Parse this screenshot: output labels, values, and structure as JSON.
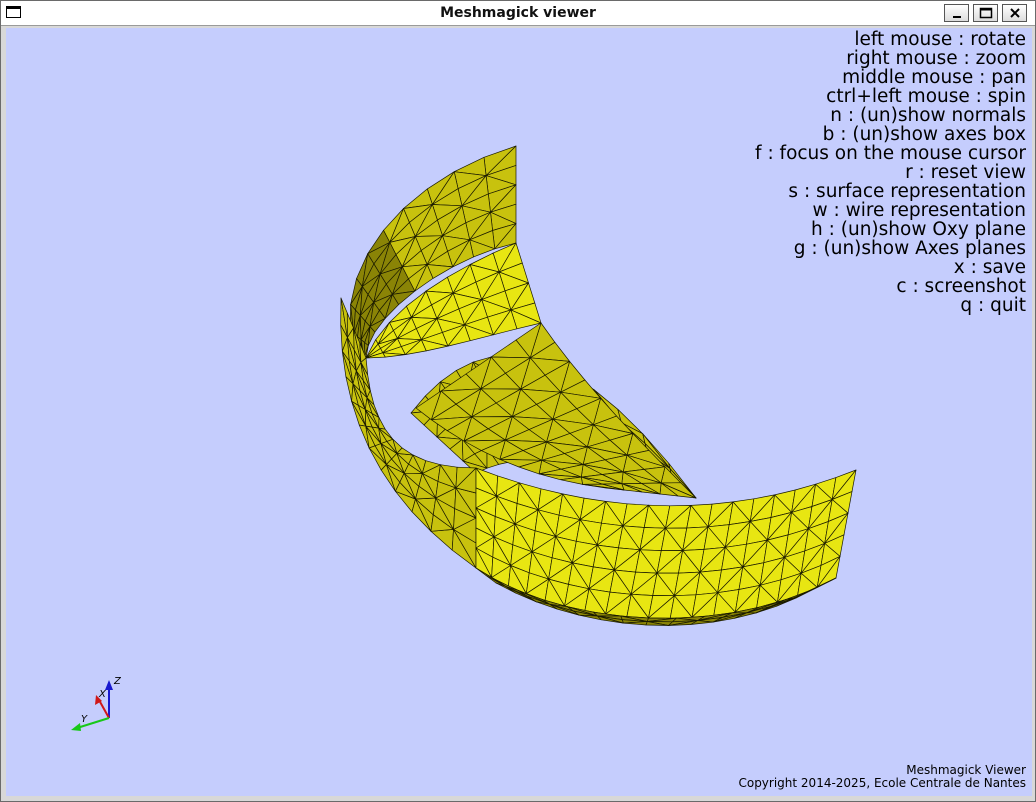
{
  "window": {
    "title": "Meshmagick viewer"
  },
  "help_lines": [
    "left mouse : rotate",
    "right mouse : zoom",
    "middle mouse : pan",
    "ctrl+left mouse : spin",
    "n : (un)show normals",
    "b : (un)show axes box",
    "f : focus on the mouse cursor",
    "r : reset view",
    "s : surface representation",
    "w : wire representation",
    "h : (un)show Oxy plane",
    "g : (un)show Axes planes",
    "x : save",
    "c : screenshot",
    "q : quit"
  ],
  "footer": {
    "app_name": "Meshmagick Viewer",
    "copyright": "Copyright 2014-2025, Ecole Centrale de Nantes"
  },
  "axes": {
    "x_label": "X",
    "y_label": "Y",
    "z_label": "Z",
    "x_color": "#d01818",
    "y_color": "#18c818",
    "z_color": "#1818d0"
  },
  "colors": {
    "viewport_bg": "#c5cdfd",
    "mesh_light": "#e8e612",
    "mesh_mid": "#c8c20e",
    "mesh_dark": "#8a8406",
    "mesh_edge": "#1a1a00"
  },
  "icons": {
    "window_icon": "window-icon",
    "minimize": "minimize-icon",
    "maximize": "maximize-icon",
    "close": "close-icon"
  }
}
